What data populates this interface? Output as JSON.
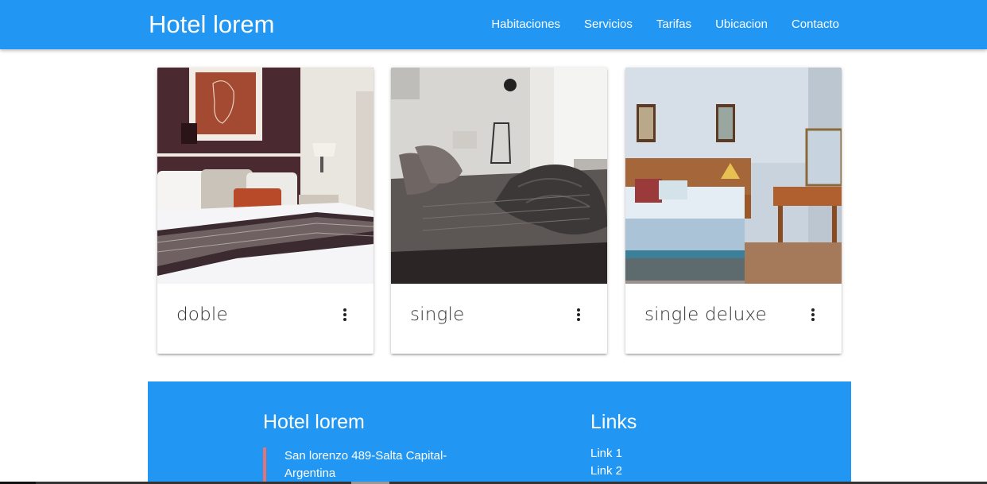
{
  "header": {
    "brand": "Hotel lorem",
    "nav": [
      "Habitaciones",
      "Servicios",
      "Tarifas",
      "Ubicacion",
      "Contacto"
    ]
  },
  "cards": [
    {
      "title": "doble",
      "icon": "more-vert-icon"
    },
    {
      "title": "single",
      "icon": "more-vert-icon"
    },
    {
      "title": "single deluxe",
      "icon": "more-vert-icon"
    }
  ],
  "footer": {
    "title": "Hotel lorem",
    "address": "San lorenzo 489-Salta Capital-Argentina",
    "links_title": "Links",
    "links": [
      "Link 1",
      "Link 2"
    ]
  },
  "colors": {
    "primary": "#2196f3",
    "accent_border": "#e57373"
  }
}
